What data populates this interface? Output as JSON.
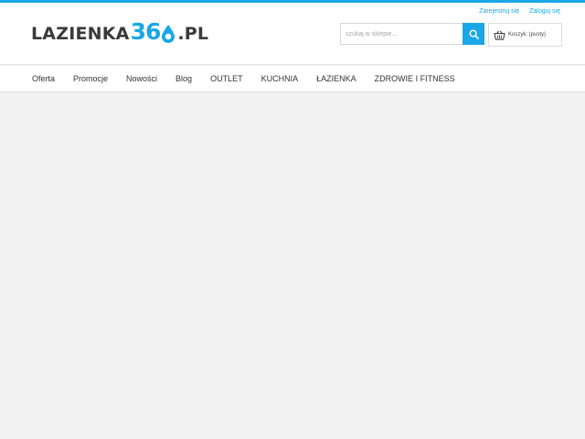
{
  "logo": {
    "text_left": "LAZIENKA",
    "text_num": "36",
    "text_right": ".PL",
    "drop_color": "#1aa7e8"
  },
  "toplinks": {
    "register": "Zarejestruj się",
    "login": "Zaloguj się"
  },
  "search": {
    "placeholder": "szukaj w sklepie...",
    "button_icon": "search-icon"
  },
  "cart": {
    "icon": "basket-icon",
    "label": "Koszyk: (pusty)"
  },
  "nav": {
    "items": [
      "Oferta",
      "Promocje",
      "Nowości",
      "Blog",
      "OUTLET",
      "KUCHNIA",
      "ŁAZIENKA",
      "ZDROWIE I FITNESS"
    ]
  },
  "colors": {
    "accent": "#1aa7e8",
    "background": "#f2f2f2"
  }
}
